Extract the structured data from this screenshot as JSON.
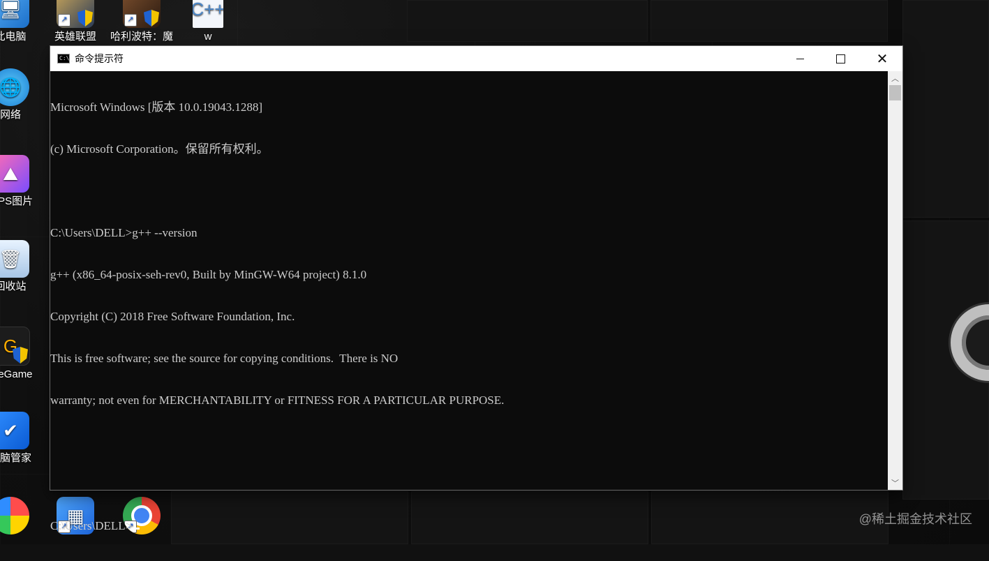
{
  "desktop": {
    "icons": [
      {
        "label": "此电脑",
        "icon": "computer-icon"
      },
      {
        "label": "网络",
        "icon": "network-icon"
      },
      {
        "label": "WPS图片",
        "icon": "wps-pictures-icon"
      },
      {
        "label": "回收站",
        "icon": "recycle-bin-icon"
      },
      {
        "label": "WeGame",
        "icon": "wegame-icon"
      },
      {
        "label": "电脑管家",
        "icon": "pc-manager-icon"
      },
      {
        "label": "英雄联盟",
        "icon": "league-of-legends-icon"
      },
      {
        "label": "哈利波特：魔",
        "icon": "harry-potter-icon"
      },
      {
        "label": "w",
        "icon": "cpp-file-icon"
      }
    ],
    "watermark": "@稀土掘金技术社区"
  },
  "window": {
    "title": "命令提示符",
    "app_icon_text": "C:\\_",
    "controls": {
      "minimize": "minimize",
      "maximize": "maximize",
      "close": "✕"
    }
  },
  "console": {
    "lines": [
      "Microsoft Windows [版本 10.0.19043.1288]",
      "(c) Microsoft Corporation。保留所有权利。",
      "",
      "C:\\Users\\DELL>g++ --version",
      "g++ (x86_64-posix-seh-rev0, Built by MinGW-W64 project) 8.1.0",
      "Copyright (C) 2018 Free Software Foundation, Inc.",
      "This is free software; see the source for copying conditions.  There is NO",
      "warranty; not even for MERCHANTABILITY or FITNESS FOR A PARTICULAR PURPOSE.",
      "",
      "",
      "C:\\Users\\DELL>"
    ]
  },
  "colors": {
    "console_bg": "#0c0c0c",
    "console_text": "#cccccc",
    "titlebar_bg": "#ffffff"
  }
}
